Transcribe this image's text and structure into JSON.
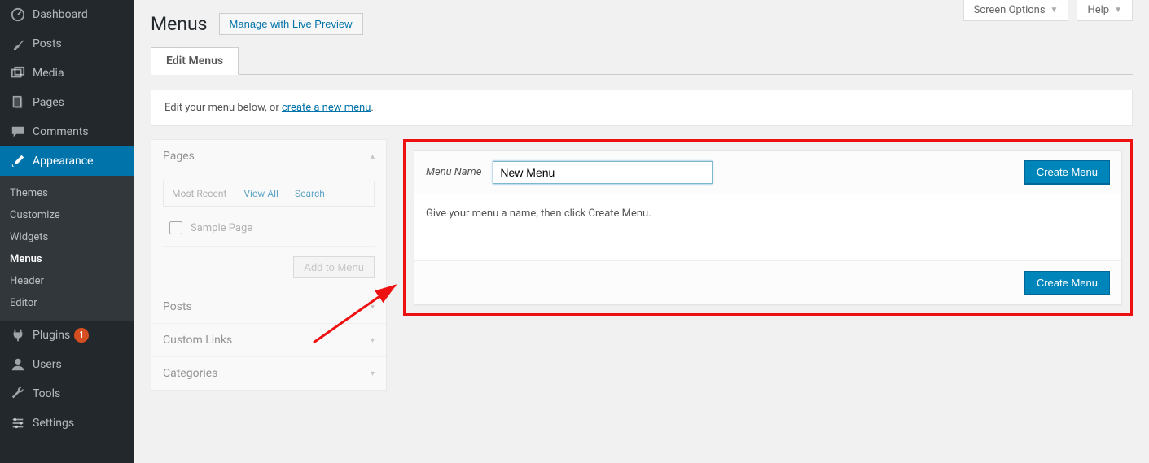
{
  "topTabs": {
    "screenOptions": "Screen Options",
    "help": "Help"
  },
  "page": {
    "title": "Menus",
    "livePreviewBtn": "Manage with Live Preview"
  },
  "navTab": "Edit Menus",
  "notice": {
    "prefix": "Edit your menu below, or ",
    "link": "create a new menu",
    "suffix": "."
  },
  "sideMetaboxes": {
    "pages": {
      "title": "Pages",
      "tabs": {
        "recent": "Most Recent",
        "viewAll": "View All",
        "search": "Search"
      },
      "item": "Sample Page",
      "addBtn": "Add to Menu"
    },
    "posts": "Posts",
    "customLinks": "Custom Links",
    "categories": "Categories"
  },
  "menuEditor": {
    "nameLabel": "Menu Name",
    "nameValue": "New Menu",
    "createBtn": "Create Menu",
    "instruction": "Give your menu a name, then click Create Menu."
  },
  "sidebar": {
    "dashboard": "Dashboard",
    "posts": "Posts",
    "media": "Media",
    "pages": "Pages",
    "comments": "Comments",
    "appearance": "Appearance",
    "plugins": "Plugins",
    "pluginsBadge": "1",
    "users": "Users",
    "tools": "Tools",
    "settings": "Settings",
    "sub": {
      "themes": "Themes",
      "customize": "Customize",
      "widgets": "Widgets",
      "menus": "Menus",
      "header": "Header",
      "editor": "Editor"
    }
  }
}
